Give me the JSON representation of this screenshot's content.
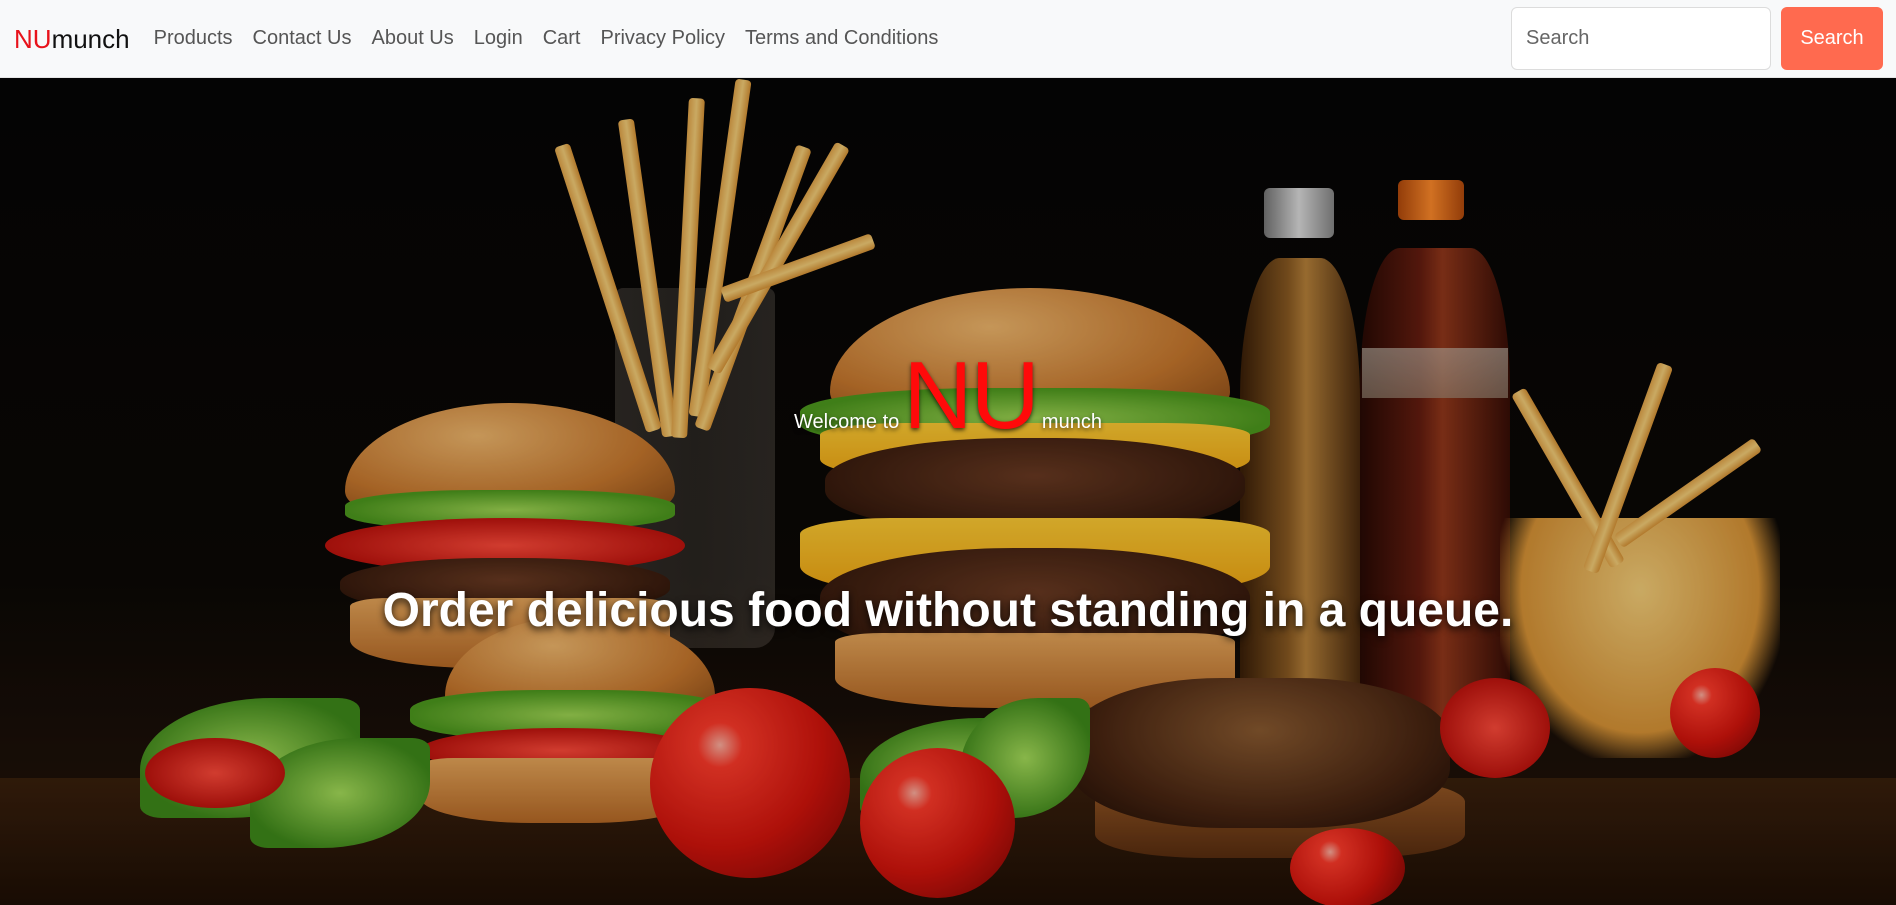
{
  "brand": {
    "prefix": "NU",
    "suffix": "munch"
  },
  "nav": {
    "items": [
      {
        "label": "Products"
      },
      {
        "label": "Contact Us"
      },
      {
        "label": "About Us"
      },
      {
        "label": "Login"
      },
      {
        "label": "Cart"
      },
      {
        "label": "Privacy Policy"
      },
      {
        "label": "Terms and Conditions"
      }
    ]
  },
  "search": {
    "placeholder": "Search",
    "button_label": "Search"
  },
  "hero": {
    "welcome_prefix": "Welcome to",
    "welcome_nu": "NU",
    "welcome_suffix": "munch",
    "tagline": "Order delicious food without standing in a queue."
  },
  "colors": {
    "brand_red": "#e8121b",
    "accent": "#ff6a4f",
    "navbar_bg": "#f8f9fa"
  }
}
